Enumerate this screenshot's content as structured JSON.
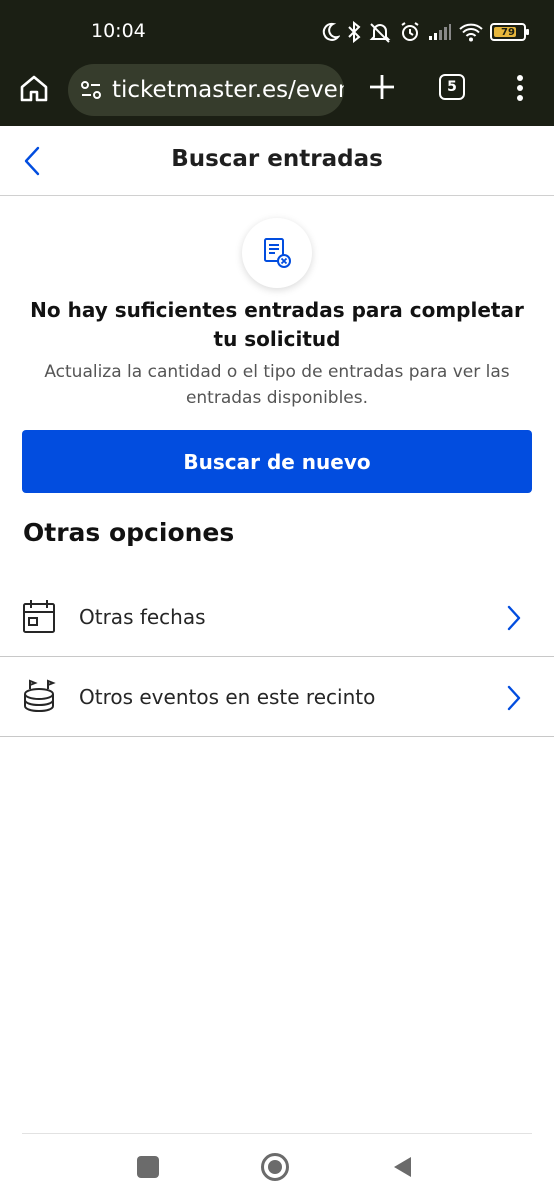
{
  "status_bar": {
    "time": "10:04",
    "battery": "79",
    "battery_level": 0.79,
    "icons": [
      "moon-icon",
      "bluetooth-icon",
      "vibrate-icon",
      "alarm-icon",
      "signal-icon",
      "wifi-icon",
      "battery-icon"
    ]
  },
  "browser": {
    "url": "ticketmaster.es/events",
    "tab_count": "5",
    "icons": [
      "home-icon",
      "site-settings-icon",
      "plus-icon",
      "tabs-icon",
      "overflow-menu-icon"
    ]
  },
  "header": {
    "title": "Buscar entradas",
    "back_icon": "chevron-left-icon"
  },
  "notice": {
    "icon": "ticket-unavailable-icon",
    "title": "No hay suficientes entradas para completar tu solicitud",
    "subtitle": "Actualiza la cantidad o el tipo de entradas para ver las entradas disponibles."
  },
  "primary_button": {
    "label": "Buscar de nuevo"
  },
  "options": {
    "heading": "Otras opciones",
    "items": [
      {
        "label": "Otras fechas",
        "icon": "calendar-icon"
      },
      {
        "label": "Otros eventos en este recinto",
        "icon": "stadium-icon"
      }
    ]
  },
  "colors": {
    "accent": "#024ddf",
    "chrome_bg": "#1b1f14",
    "url_pill_bg": "#363c2c",
    "battery": "#e6b63c",
    "chevron": "#024ddf"
  },
  "nav_bar": {
    "icons": [
      "recent-apps-icon",
      "home-circle-icon",
      "back-triangle-icon"
    ]
  }
}
